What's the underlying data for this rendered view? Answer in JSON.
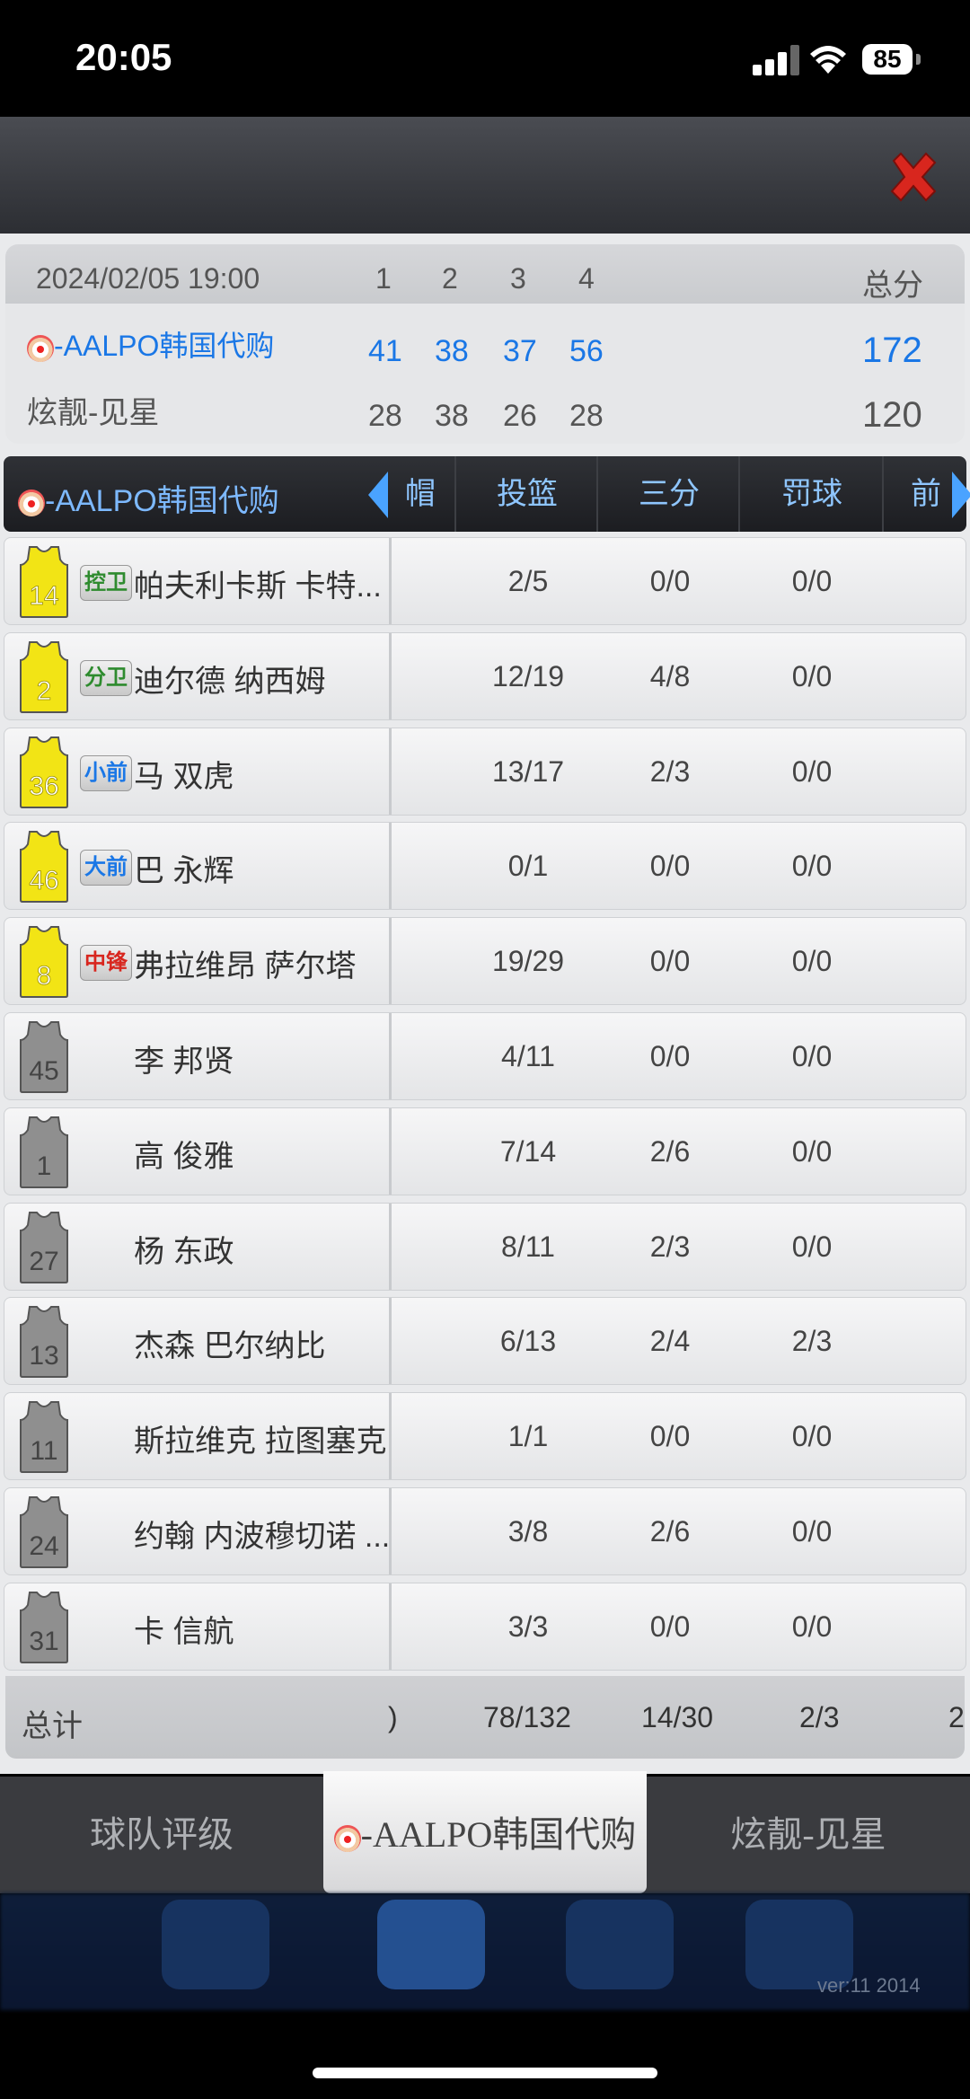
{
  "status": {
    "time": "20:05",
    "battery": "85"
  },
  "score": {
    "date": "2024/02/05 19:00",
    "quarters": [
      "1",
      "2",
      "3",
      "4"
    ],
    "total_label": "总分",
    "team_a": {
      "name": "-AALPO韩国代购",
      "q": [
        "41",
        "38",
        "37",
        "56"
      ],
      "total": "172"
    },
    "team_b": {
      "name": "炫靓-见星",
      "q": [
        "28",
        "38",
        "26",
        "28"
      ],
      "total": "120"
    }
  },
  "table": {
    "team_name": "-AALPO韩国代购",
    "columns": [
      "帽",
      "投篮",
      "三分",
      "罚球",
      "前"
    ],
    "rows": [
      {
        "number": "14",
        "pos": "控卫",
        "name": "帕夫利卡斯 卡特...",
        "fg": "2/5",
        "tp": "0/0",
        "ft": "0/0",
        "starter": true
      },
      {
        "number": "2",
        "pos": "分卫",
        "name": "迪尔德 纳西姆",
        "fg": "12/19",
        "tp": "4/8",
        "ft": "0/0",
        "starter": true
      },
      {
        "number": "36",
        "pos": "小前",
        "name": "马 双虎",
        "fg": "13/17",
        "tp": "2/3",
        "ft": "0/0",
        "starter": true
      },
      {
        "number": "46",
        "pos": "大前",
        "name": "巴 永辉",
        "fg": "0/1",
        "tp": "0/0",
        "ft": "0/0",
        "starter": true
      },
      {
        "number": "8",
        "pos": "中锋",
        "name": "弗拉维昂 萨尔塔",
        "fg": "19/29",
        "tp": "0/0",
        "ft": "0/0",
        "starter": true
      },
      {
        "number": "45",
        "pos": "",
        "name": "李 邦贤",
        "fg": "4/11",
        "tp": "0/0",
        "ft": "0/0",
        "starter": false
      },
      {
        "number": "1",
        "pos": "",
        "name": "高 俊雅",
        "fg": "7/14",
        "tp": "2/6",
        "ft": "0/0",
        "starter": false
      },
      {
        "number": "27",
        "pos": "",
        "name": "杨 东政",
        "fg": "8/11",
        "tp": "2/3",
        "ft": "0/0",
        "starter": false
      },
      {
        "number": "13",
        "pos": "",
        "name": "杰森 巴尔纳比",
        "fg": "6/13",
        "tp": "2/4",
        "ft": "2/3",
        "starter": false
      },
      {
        "number": "11",
        "pos": "",
        "name": "斯拉维克 拉图塞克",
        "fg": "1/1",
        "tp": "0/0",
        "ft": "0/0",
        "starter": false
      },
      {
        "number": "24",
        "pos": "",
        "name": "约翰 内波穆切诺 ...",
        "fg": "3/8",
        "tp": "2/6",
        "ft": "0/0",
        "starter": false
      },
      {
        "number": "31",
        "pos": "",
        "name": "卡 信航",
        "fg": "3/3",
        "tp": "0/0",
        "ft": "0/0",
        "starter": false
      }
    ],
    "total": {
      "label": "总计",
      "fg": "78/132",
      "tp": "14/30",
      "ft": "2/3"
    }
  },
  "bottom_tabs": {
    "rating": "球队评级",
    "team_a": "-AALPO韩国代购",
    "team_b": "炫靓-见星"
  },
  "version": "ver:11 2014",
  "colors": {
    "starter_jersey": "#f2e415",
    "bench_jersey": "#8f8f8f",
    "accent_blue": "#1a77e6",
    "close_red": "#d8261e"
  },
  "pos_colors": {
    "控卫": "#2e8b2e",
    "分卫": "#2e8b2e",
    "小前": "#1a77e6",
    "大前": "#1a77e6",
    "中锋": "#d8261e"
  }
}
